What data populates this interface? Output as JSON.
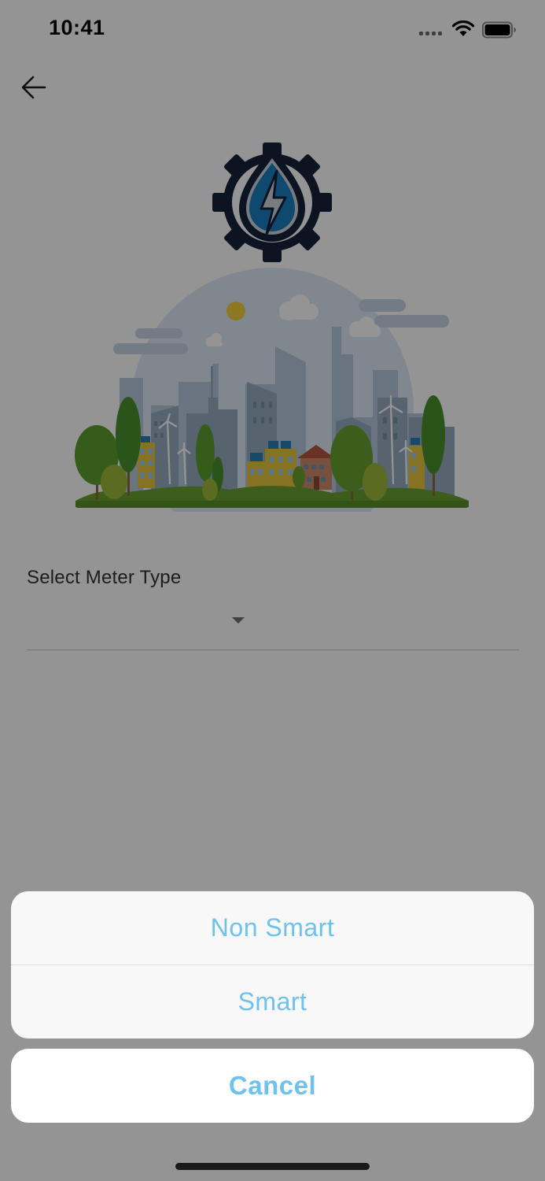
{
  "status_bar": {
    "time": "10:41"
  },
  "icons": {
    "back": "arrow-left-icon",
    "logo": "water-lightning-gear-icon",
    "illustration": "green-city-illustration",
    "dropdown": "triangle-down-icon",
    "wifi": "wifi-icon",
    "battery": "battery-icon",
    "signal": "cellular-signal-icon"
  },
  "form": {
    "label": "Select Meter Type",
    "value": ""
  },
  "action_sheet": {
    "options": [
      "Non Smart",
      "Smart"
    ],
    "cancel": "Cancel"
  },
  "colors": {
    "accent": "#6fc1ef",
    "logo_dark": "#16233a",
    "logo_blue": "#1d7fc2",
    "overlay": "rgba(0,0,0,0.42)"
  }
}
